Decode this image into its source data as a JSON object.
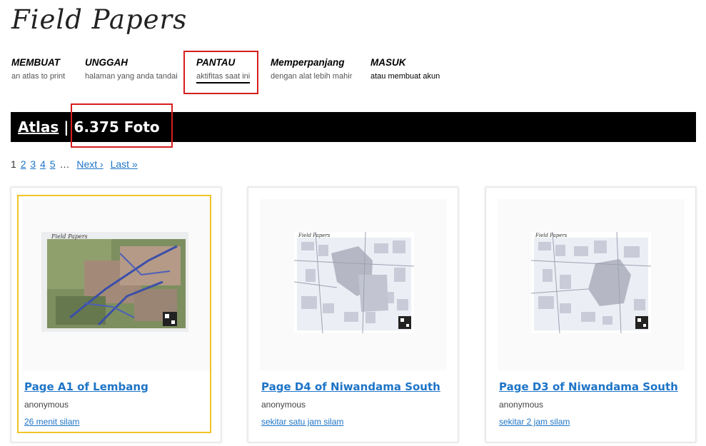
{
  "logo": "Field Papers",
  "nav": [
    {
      "title": "MEMBUAT",
      "subtitle": "an atlas to print"
    },
    {
      "title": "UNGGAH",
      "subtitle": "halaman yang anda tandai"
    },
    {
      "title": "PANTAU",
      "subtitle": "aktifitas saat ini"
    },
    {
      "title": "Memperpanjang",
      "subtitle": "dengan alat lebih mahir"
    },
    {
      "title": "MASUK",
      "subtitle": "atau membuat akun"
    }
  ],
  "banner": {
    "atlas_link": "Atlas",
    "separator": "|",
    "count_label": "6.375 Foto"
  },
  "pagination": {
    "current": "1",
    "pages": [
      "2",
      "3",
      "4",
      "5"
    ],
    "ellipsis": "…",
    "next": "Next ›",
    "last": "Last »"
  },
  "cards": [
    {
      "title": "Page A1 of Lembang",
      "author": "anonymous",
      "time": "26 menit silam",
      "thumb_logo": "Field Papers"
    },
    {
      "title": "Page D4 of Niwandama South",
      "author": "anonymous",
      "time": "sekitar satu jam silam",
      "thumb_logo": "Field Papers"
    },
    {
      "title": "Page D3 of Niwandama South",
      "author": "anonymous",
      "time": "sekitar 2 jam silam",
      "thumb_logo": "Field Papers"
    }
  ],
  "colors": {
    "link": "#1e74c6",
    "highlight_red": "#d61e1e",
    "selected_yellow": "#f0c425",
    "banner_bg": "#000000"
  }
}
